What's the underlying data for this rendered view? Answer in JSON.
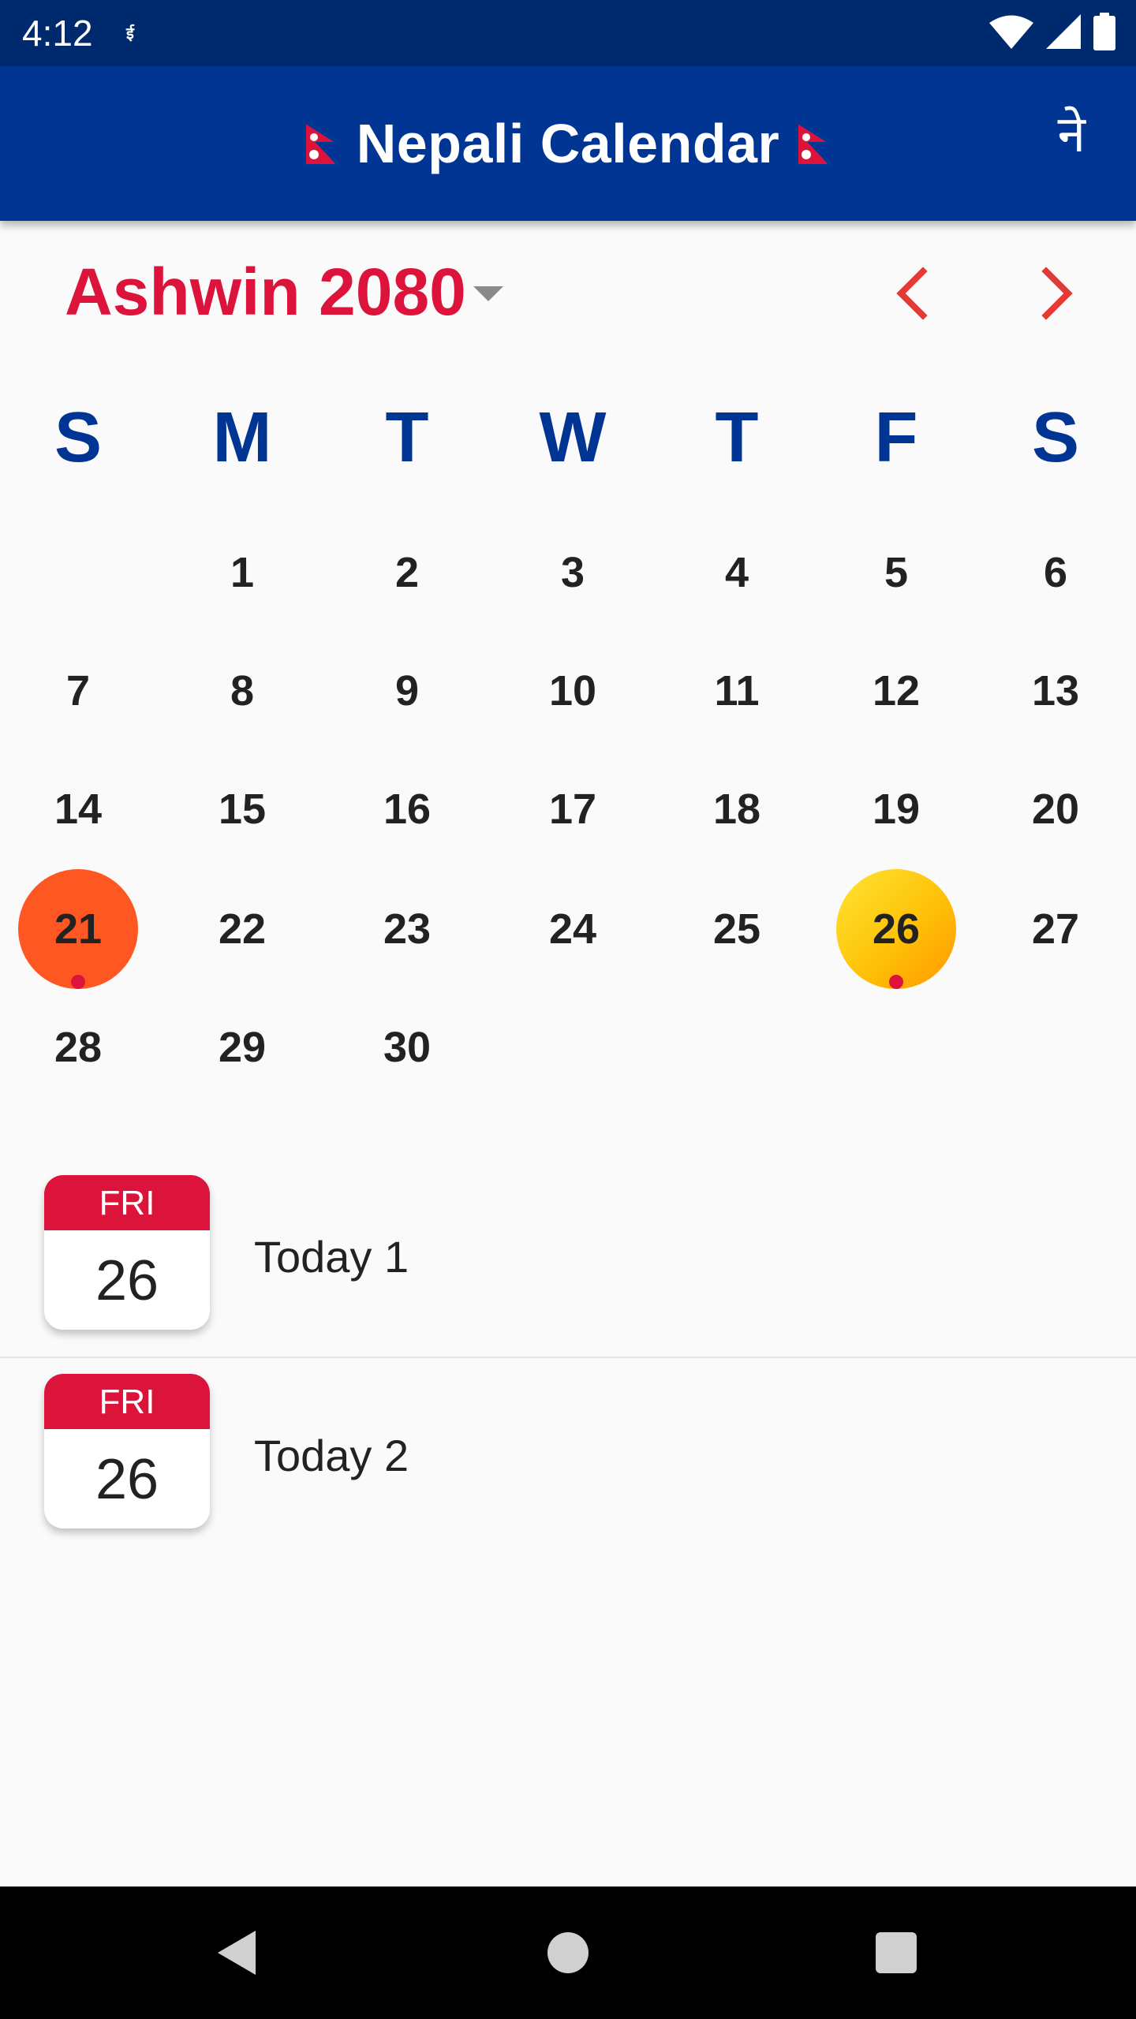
{
  "status_bar": {
    "time": "4:12",
    "app_icon_text": "ई",
    "icons": [
      "wifi-icon",
      "signal-icon",
      "battery-icon"
    ]
  },
  "app_bar": {
    "title": "Nepali Calendar",
    "language_toggle": "ने"
  },
  "month_header": {
    "month_year": "Ashwin 2080",
    "dropdown_icon": "arrow-drop-down-icon",
    "prev_icon": "chevron-left-icon",
    "next_icon": "chevron-right-icon"
  },
  "weekdays": [
    "S",
    "M",
    "T",
    "W",
    "T",
    "F",
    "S"
  ],
  "calendar": {
    "first_weekday_index": 1,
    "days_in_month": 30,
    "today": "21",
    "selected": "26",
    "event_days": [
      "21",
      "26"
    ]
  },
  "events": [
    {
      "weekday": "FRI",
      "day": "26",
      "title": "Today 1"
    },
    {
      "weekday": "FRI",
      "day": "26",
      "title": "Today 2"
    }
  ],
  "nav_bar": {
    "buttons": [
      "back-icon",
      "home-icon",
      "recents-icon"
    ]
  },
  "colors": {
    "primary": "#003594",
    "status_bar": "#002a6e",
    "accent_red": "#dc143c",
    "today": "#ff5722",
    "selected": "#ffc107",
    "nav_arrow": "#e53935"
  }
}
